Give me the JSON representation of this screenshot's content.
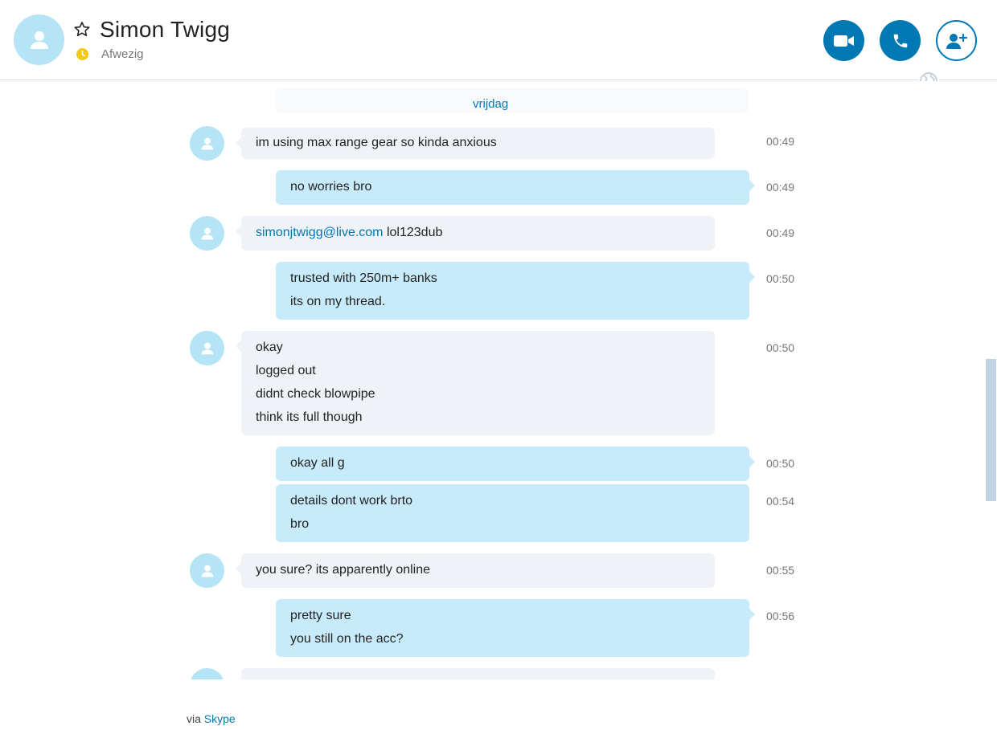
{
  "header": {
    "contact_name": "Simon Twigg",
    "status": "Afwezig",
    "status_color": "#f2c811",
    "accent_color": "#0078b4"
  },
  "chat": {
    "date_separator": "vrijdag",
    "messages": [
      {
        "direction": "in",
        "lines": [
          "im using max range gear so kinda anxious"
        ],
        "time": "00:49"
      },
      {
        "direction": "out",
        "lines": [
          "no worries bro"
        ],
        "time": "00:49"
      },
      {
        "direction": "in",
        "link": "simonjtwigg@live.com",
        "text": " lol123dub",
        "time": "00:49"
      },
      {
        "direction": "out",
        "lines": [
          "trusted with 250m+ banks",
          "its on my thread."
        ],
        "time": "00:50"
      },
      {
        "direction": "in",
        "lines": [
          "okay",
          "logged out",
          "didnt check blowpipe",
          "think its full though"
        ],
        "time": "00:50"
      },
      {
        "direction": "out",
        "lines": [
          "okay all g"
        ],
        "time": "00:50"
      },
      {
        "direction": "out",
        "lines": [
          "details dont work brto",
          "bro"
        ],
        "time": "00:54"
      },
      {
        "direction": "in",
        "lines": [
          "you sure? its apparently online"
        ],
        "time": "00:55"
      },
      {
        "direction": "out",
        "lines": [
          "pretty sure",
          "you still on the acc?"
        ],
        "time": "00:56"
      }
    ]
  },
  "footer": {
    "via": "via",
    "skype": "Skype"
  }
}
